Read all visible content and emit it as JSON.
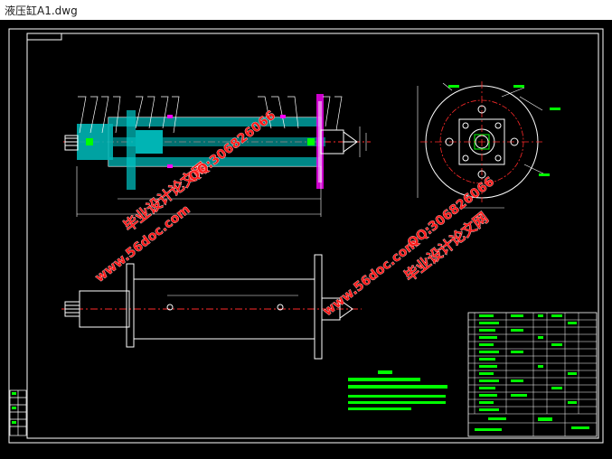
{
  "window": {
    "title": "液压缸A1.dwg"
  },
  "watermarks": {
    "left": {
      "line1": "毕业设计论文网",
      "line2": "QQ:306826066",
      "line3": "www.56doc.com"
    },
    "right": {
      "line1": "毕业设计论文网",
      "line2": "QQ:306826066",
      "line3": "www.56doc.com"
    }
  },
  "colors": {
    "background": "#000000",
    "frame": "#ffffff",
    "centerline": "#ff2a2a",
    "hatch": "#00c8c8",
    "part": "#00ff00",
    "accent": "#ff00ff",
    "watermark": "#ff1a1a"
  },
  "drawing_type": "cad-assembly-drawing"
}
